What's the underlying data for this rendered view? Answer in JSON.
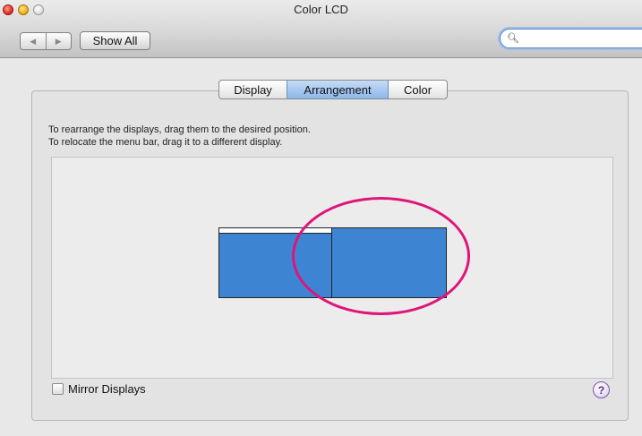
{
  "window": {
    "title": "Color LCD"
  },
  "toolbar": {
    "back_icon": "triangle-left-icon",
    "forward_icon": "triangle-right-icon",
    "show_all_label": "Show All",
    "search_placeholder": "",
    "search_icon": "magnifier-icon"
  },
  "tabs": [
    {
      "label": "Display",
      "selected": false
    },
    {
      "label": "Arrangement",
      "selected": true
    },
    {
      "label": "Color",
      "selected": false
    }
  ],
  "instructions": {
    "line1": "To rearrange the displays, drag them to the desired position.",
    "line2": "To relocate the menu bar, drag it to a different display."
  },
  "displays": {
    "color": "#3d85d3",
    "highlight_color": "#e0147a"
  },
  "mirror": {
    "label": "Mirror Displays",
    "checked": false
  },
  "help": {
    "label": "?"
  }
}
